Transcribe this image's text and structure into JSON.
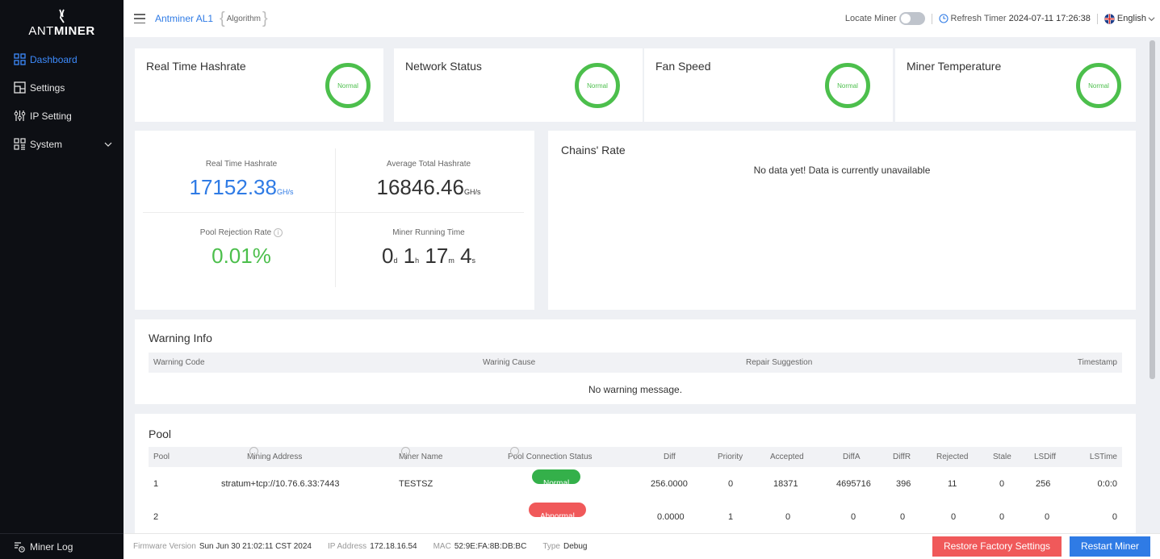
{
  "brand": {
    "logo_text_light": "ANT",
    "logo_text_bold": "MINER"
  },
  "sidebar": {
    "items": [
      {
        "label": "Dashboard",
        "icon": "dashboard-icon",
        "active": true
      },
      {
        "label": "Settings",
        "icon": "settings-icon"
      },
      {
        "label": "IP Setting",
        "icon": "ip-setting-icon"
      },
      {
        "label": "System",
        "icon": "system-icon",
        "expandable": true
      }
    ],
    "footer_label": "Miner Log"
  },
  "header": {
    "miner_model": "Antminer AL1",
    "algorithm": "Algorithm",
    "locate_label": "Locate Miner",
    "refresh_label": "Refresh Timer",
    "refresh_time": "2024-07-11 17:26:38",
    "language": "English"
  },
  "status_cards": [
    {
      "title": "Real Time Hashrate",
      "status": "Normal"
    },
    {
      "title": "Network Status",
      "status": "Normal"
    },
    {
      "title": "Fan Speed",
      "status": "Normal"
    },
    {
      "title": "Miner Temperature",
      "status": "Normal"
    }
  ],
  "stats": {
    "rt_label": "Real Time Hashrate",
    "rt_value": "17152.38",
    "rt_unit": "GH/s",
    "avg_label": "Average Total Hashrate",
    "avg_value": "16846.46",
    "avg_unit": "GH/s",
    "rej_label": "Pool Rejection Rate",
    "rej_value": "0.01%",
    "run_label": "Miner Running Time",
    "run_d": "0",
    "run_d_u": "d",
    "run_h": "1",
    "run_h_u": "h",
    "run_m": "17",
    "run_m_u": "m",
    "run_s": "4",
    "run_s_u": "s"
  },
  "chains": {
    "title": "Chains' Rate",
    "empty": "No data yet! Data is currently unavailable"
  },
  "warning": {
    "title": "Warning Info",
    "columns": [
      "Warning Code",
      "Warinig Cause",
      "Repair Suggestion",
      "Timestamp"
    ],
    "empty": "No warning message."
  },
  "pool": {
    "title": "Pool",
    "columns": [
      "Pool",
      "Mining Address",
      "Miner Name",
      "Pool Connection Status",
      "Diff",
      "Priority",
      "Accepted",
      "DiffA",
      "DiffR",
      "Rejected",
      "Stale",
      "LSDiff",
      "LSTime"
    ],
    "rows": [
      [
        "1",
        "stratum+tcp://10.76.6.33:7443",
        "TESTSZ",
        "Normal",
        "256.0000",
        "0",
        "18371",
        "4695716",
        "396",
        "11",
        "0",
        "256",
        "0:0:0"
      ],
      [
        "2",
        "",
        "",
        "Abnormal",
        "0.0000",
        "1",
        "0",
        "0",
        "0",
        "0",
        "0",
        "0",
        "0"
      ]
    ]
  },
  "footer": {
    "fw_label": "Firmware Version",
    "fw_value": "Sun Jun 30 21:02:11 CST 2024",
    "ip_label": "IP Address",
    "ip_value": "172.18.16.54",
    "mac_label": "MAC",
    "mac_value": "52:9E:FA:8B:DB:BC",
    "type_label": "Type",
    "type_value": "Debug",
    "restore_label": "Restore Factory Settings",
    "restart_label": "Restart Miner"
  },
  "colors": {
    "accent": "#2f7be5",
    "ok": "#34b04a",
    "bad": "#f0595a",
    "sidebar": "#0d0f14"
  }
}
